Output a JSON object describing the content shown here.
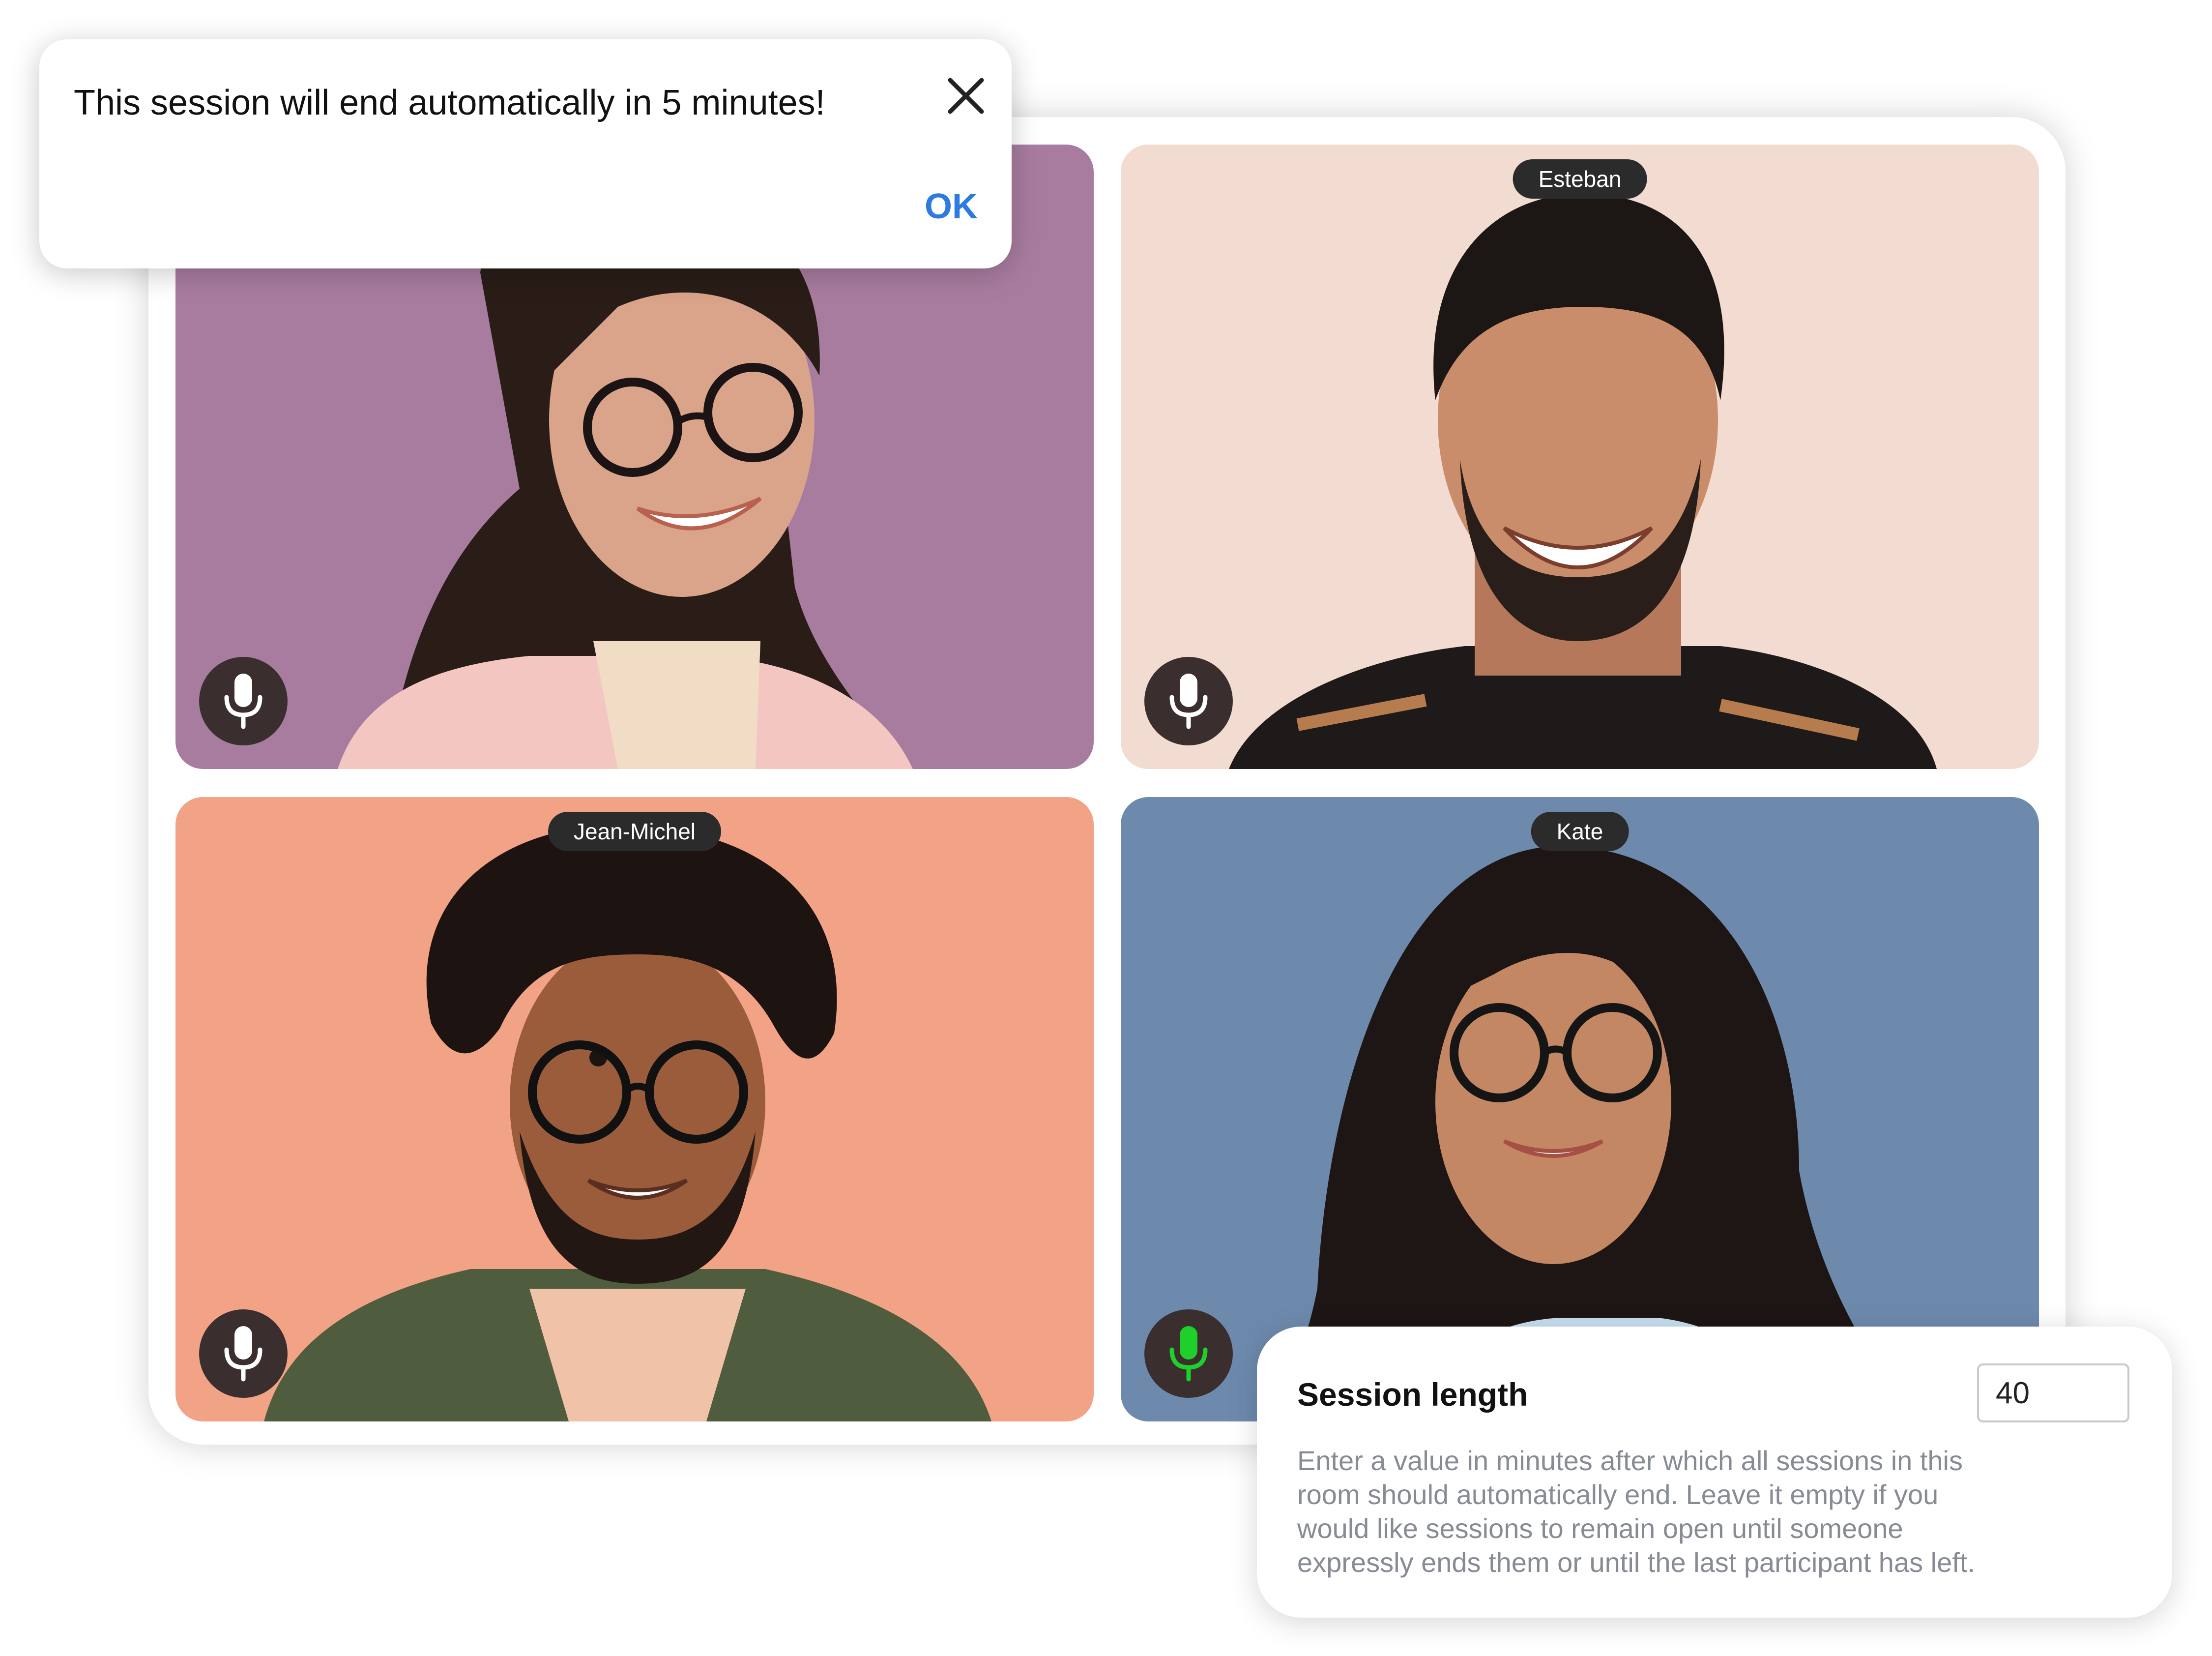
{
  "dialog": {
    "message": "This session will end automatically in 5 minutes!",
    "ok_label": "OK",
    "close_icon": "close-icon"
  },
  "participants": [
    {
      "name": "",
      "background": "#a87c9f",
      "mic_active": false
    },
    {
      "name": "Esteban",
      "background": "#f2dbd0",
      "mic_active": false
    },
    {
      "name": "Jean-Michel",
      "background": "#f2a386",
      "mic_active": false
    },
    {
      "name": "Kate",
      "background": "#6d8aad",
      "mic_active": true
    }
  ],
  "colors": {
    "mic_idle": "#ffffff",
    "mic_active": "#1fcf2a",
    "accent": "#2e7be0"
  },
  "settings": {
    "title": "Session length",
    "value": "40",
    "help": "Enter a value in minutes after which all sessions in this room should automatically end. Leave it empty if you would like sessions to remain open until someone expressly ends them or until the last participant has left."
  }
}
